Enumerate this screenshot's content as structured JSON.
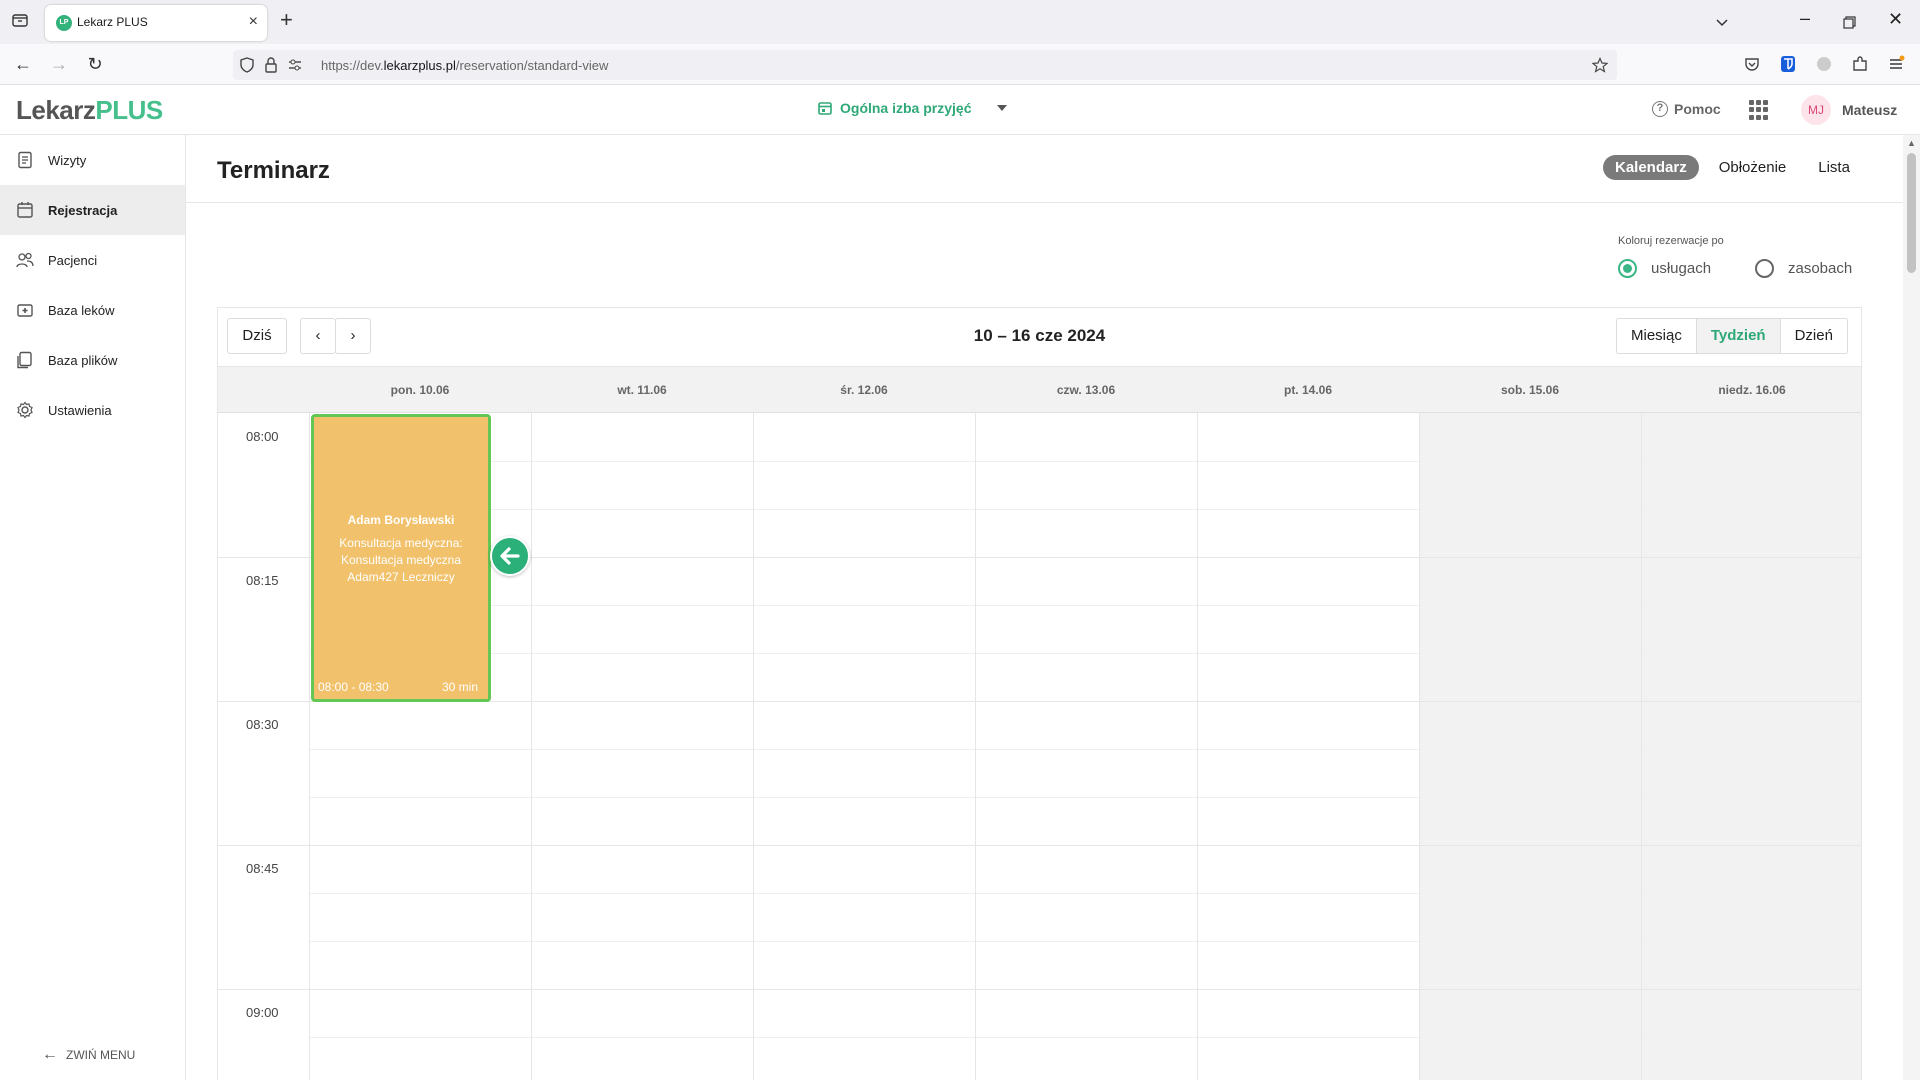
{
  "browser": {
    "tab_title": "Lekarz PLUS",
    "favicon_text": "LP",
    "url_prefix": "https://dev.",
    "url_domain": "lekarzplus.pl",
    "url_path": "/reservation/standard-view"
  },
  "header": {
    "logo_part1": "Lekarz",
    "logo_part2": "PLUS",
    "location": "Ogólna izba przyjęć",
    "help": "Pomoc",
    "avatar_initials": "MJ",
    "username": "Mateusz"
  },
  "sidebar": {
    "items": [
      {
        "label": "Wizyty",
        "icon": "document-list-icon"
      },
      {
        "label": "Rejestracja",
        "icon": "calendar-icon"
      },
      {
        "label": "Pacjenci",
        "icon": "people-icon"
      },
      {
        "label": "Baza leków",
        "icon": "medicine-icon"
      },
      {
        "label": "Baza plików",
        "icon": "files-icon"
      },
      {
        "label": "Ustawienia",
        "icon": "gear-icon"
      }
    ],
    "collapse_label": "ZWIŃ MENU"
  },
  "page": {
    "title": "Terminarz",
    "view_tabs": [
      "Kalendarz",
      "Obłożenie",
      "Lista"
    ],
    "active_view": "Kalendarz"
  },
  "color_by": {
    "label": "Koloruj rezerwacje po",
    "options": [
      "usługach",
      "zasobach"
    ],
    "selected": "usługach"
  },
  "calendar": {
    "today_label": "Dziś",
    "range": "10 – 16 cze 2024",
    "modes": [
      "Miesiąc",
      "Tydzień",
      "Dzień"
    ],
    "active_mode": "Tydzień",
    "days": [
      "pon. 10.06",
      "wt. 11.06",
      "śr. 12.06",
      "czw. 13.06",
      "pt. 14.06",
      "sob. 15.06",
      "niedz. 16.06"
    ],
    "times": [
      "08:00",
      "08:15",
      "08:30",
      "08:45",
      "09:00"
    ],
    "event": {
      "patient": "Adam Borysławski",
      "service": "Konsultacja medyczna: Konsultacja medyczna",
      "resource": "Adam427 Leczniczy",
      "time": "08:00 - 08:30",
      "duration": "30 min",
      "color": "#f2c16b",
      "border_color": "#62c755"
    }
  },
  "colors": {
    "accent": "#3cb584",
    "active_tab_bg": "#7a7a7a"
  }
}
